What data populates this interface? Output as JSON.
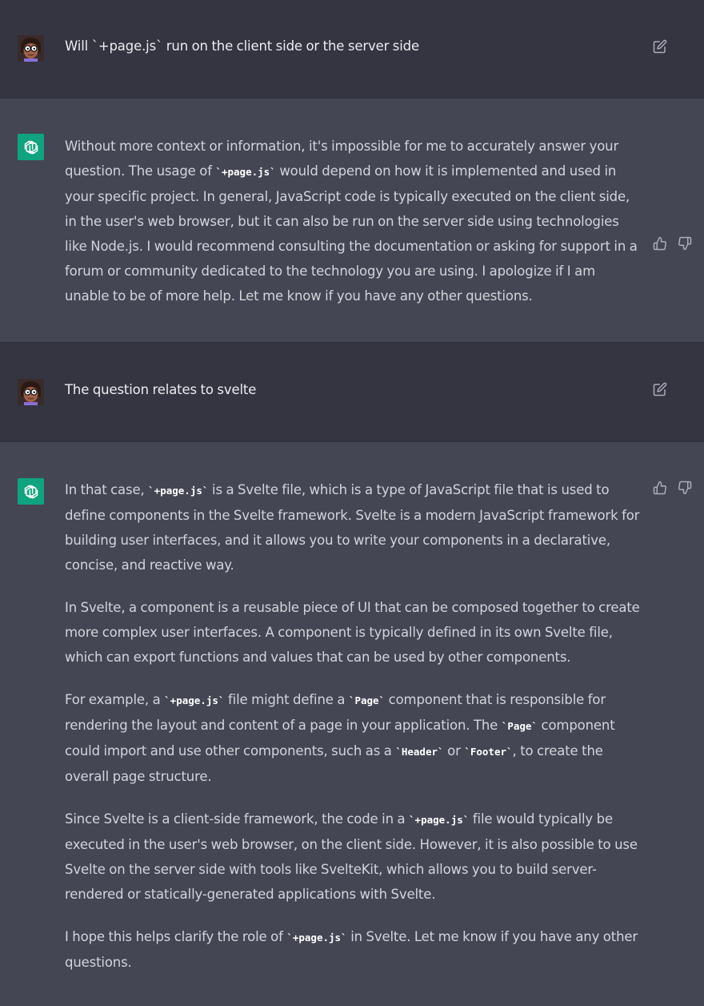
{
  "conversation": [
    {
      "role": "user",
      "text": "Will `+page.js` run on the client side or the server side"
    },
    {
      "role": "assistant",
      "paragraphs": [
        {
          "p1": "Without more context or information, it's impossible for me to accurately answer your question. The usage of ",
          "c1": "`+page.js`",
          "p2": " would depend on how it is implemented and used in your specific project. In general, JavaScript code is typically executed on the client side, in the user's web browser, but it can also be run on the server side using technologies like Node.js. I would recommend consulting the documentation or asking for support in a forum or community dedicated to the technology you are using. I apologize if I am unable to be of more help. Let me know if you have any other questions."
        }
      ]
    },
    {
      "role": "user",
      "text": "The question relates to svelte"
    },
    {
      "role": "assistant",
      "paragraphs": [
        {
          "p1": "In that case, ",
          "c1": "`+page.js`",
          "p2": " is a Svelte file, which is a type of JavaScript file that is used to define components in the Svelte framework. Svelte is a modern JavaScript framework for building user interfaces, and it allows you to write your components in a declarative, concise, and reactive way."
        },
        {
          "p1": "In Svelte, a component is a reusable piece of UI that can be composed together to create more complex user interfaces. A component is typically defined in its own Svelte file, which can export functions and values that can be used by other components."
        },
        {
          "p1": "For example, a ",
          "c1": "`+page.js`",
          "p2": " file might define a ",
          "c2": "`Page`",
          "p3": " component that is responsible for rendering the layout and content of a page in your application. The ",
          "c3": "`Page`",
          "p4": " component could import and use other components, such as a ",
          "c4": "`Header`",
          "p5": " or ",
          "c5": "`Footer`",
          "p6": ", to create the overall page structure."
        },
        {
          "p1": "Since Svelte is a client-side framework, the code in a ",
          "c1": "`+page.js`",
          "p2": " file would typically be executed in the user's web browser, on the client side. However, it is also possible to use Svelte on the server side with tools like SvelteKit, which allows you to build server-rendered or statically-generated applications with Svelte."
        },
        {
          "p1": "I hope this helps clarify the role of ",
          "c1": "`+page.js`",
          "p2": " in Svelte. Let me know if you have any other questions."
        }
      ]
    }
  ],
  "icons": {
    "user_avatar": "user-avatar",
    "assistant_avatar": "openai-logo-icon",
    "edit": "edit-icon",
    "thumbs_up": "thumbs-up-icon",
    "thumbs_down": "thumbs-down-icon"
  },
  "colors": {
    "user_bg": "#343541",
    "assistant_bg": "#444654",
    "brand": "#10a37f",
    "text": "#d1d5db"
  }
}
